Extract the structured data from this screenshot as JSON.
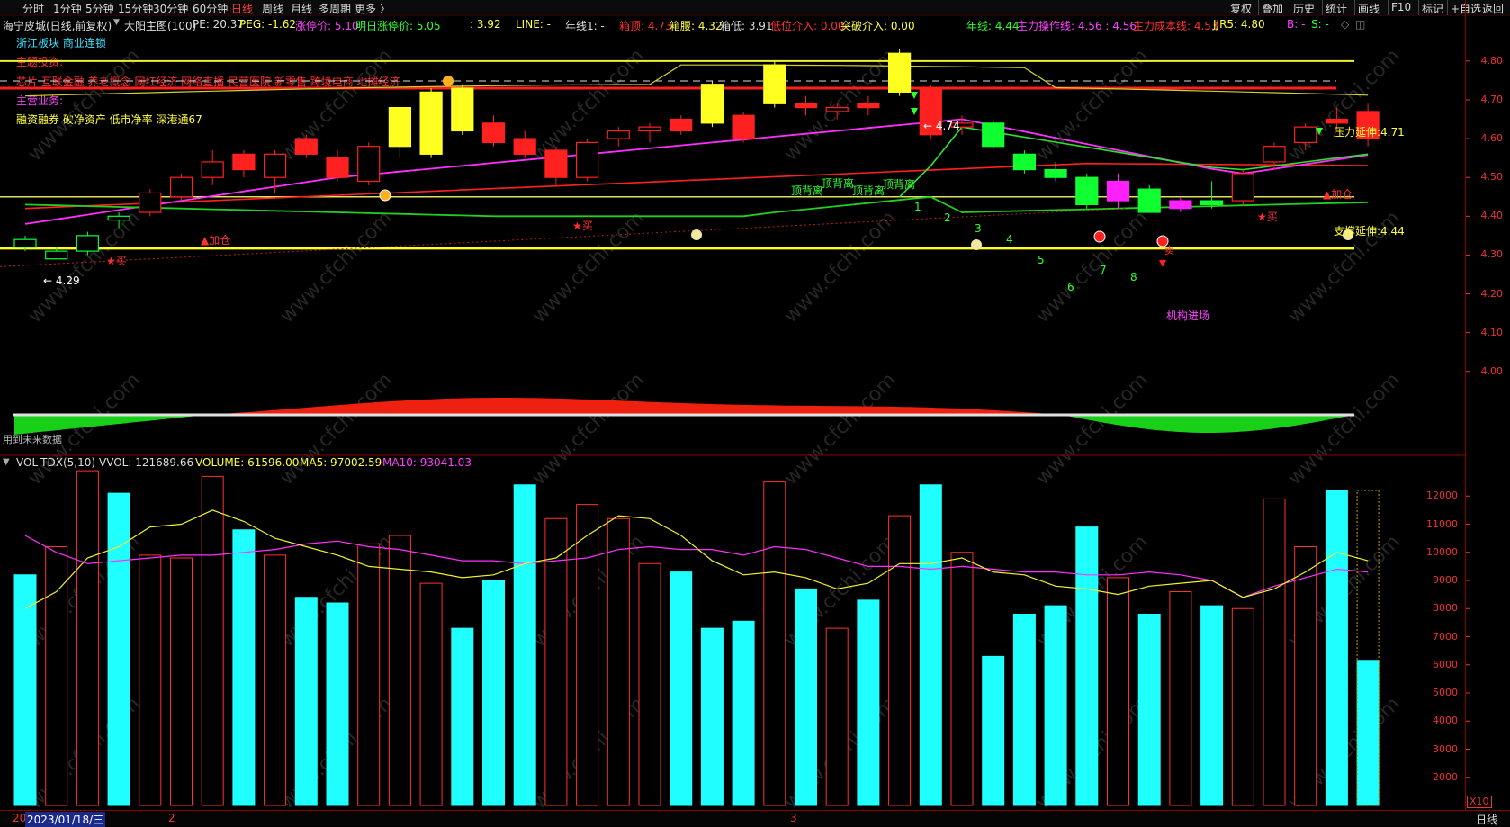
{
  "toolbar": {
    "period_tabs": [
      "分时",
      "1分钟",
      "5分钟",
      "15分钟",
      "30分钟",
      "60分钟",
      "日线",
      "周线",
      "月线",
      "多周期",
      "更多 〉"
    ],
    "selected_period": "日线",
    "right_buttons": [
      "复权",
      "叠加",
      "历史",
      "统计",
      "画线",
      "F10",
      "标记",
      "+自选",
      "返回"
    ]
  },
  "info_line": {
    "stock": "海宁皮城(日线,前复权)",
    "indicator": "大阳主图(100)",
    "pe": "PE: 20.37",
    "peg": "PEG: -1.62",
    "limit_up": "涨停价: 5.10",
    "next_limit_up": "明日涨停价: 5.05",
    "val1": ": 3.92",
    "line": "LINE: -",
    "year_line1": "年线1: -",
    "box_top": "箱顶: 4.73",
    "box_mid": "箱腰: 4.32",
    "box_low": "箱低: 3.91",
    "low_entry": "低位介入: 0.00",
    "break_entry": "突破介入: 0.00",
    "year_line": "年线: 4.44",
    "main_op": "主力操作线: 4.56 : 4.56",
    "main_cost": "主力成本线: 4.53",
    "jjr5": "JJR5: 4.80",
    "b": "B: -",
    "s": "S: -"
  },
  "overlay": {
    "sector": "浙江板块  商业连锁",
    "theme_label": "主题投资:",
    "themes": "芯片  互联金融  养老概念  网红经济  网络直播  民营医院  新零售  跨境电商  地摊经济",
    "business_label": "主营业务:",
    "business": "融资融券  破净资产  低市净率  深港通67",
    "watermark": "www.cfchi.com"
  },
  "annotations": {
    "buy": "★买",
    "add_pos": "▲加仓",
    "top_divergence": "顶背离",
    "pressure": "压力延伸:4.71",
    "support": "支撑延伸:4.44",
    "institution": "机构进场",
    "low_price": "← 4.29",
    "high_price": "← 4.74",
    "counts": [
      "1",
      "2",
      "3",
      "4",
      "5",
      "6",
      "7",
      "8"
    ],
    "sell": "卖"
  },
  "price_axis": [
    "4.80",
    "4.70",
    "4.60",
    "4.50",
    "4.40",
    "4.30",
    "4.20",
    "4.10",
    "4.00"
  ],
  "volume_info": {
    "name": "VOL-TDX(5,10)",
    "vvol": "VVOL: 121689.66",
    "volume": "VOLUME: 61596.00",
    "ma5": "MA5: 97002.59",
    "ma10": "MA10: 93041.03"
  },
  "volume_axis": [
    "12000",
    "11000",
    "10000",
    "9000",
    "8000",
    "7000",
    "6000",
    "5000",
    "4000",
    "3000",
    "2000"
  ],
  "volume_unit": "X10",
  "date_bar": {
    "date": "2023/01/18/三",
    "m1": "20",
    "m2": "2",
    "m3": "3",
    "period": "日线"
  },
  "footer_note": "用到未来数据",
  "colors": {
    "up": "#ff2020",
    "down": "#00ff40",
    "yellow": "#ffff20",
    "magenta": "#ff20ff",
    "cyan": "#20ffff"
  },
  "chart_data": {
    "type": "candlestick",
    "candles": [
      {
        "o": 4.34,
        "c": 4.32,
        "h": 4.35,
        "l": 4.31,
        "t": "down"
      },
      {
        "o": 4.31,
        "c": 4.29,
        "h": 4.32,
        "l": 4.29,
        "t": "down"
      },
      {
        "o": 4.35,
        "c": 4.31,
        "h": 4.36,
        "l": 4.3,
        "t": "down"
      },
      {
        "o": 4.39,
        "c": 4.4,
        "h": 4.41,
        "l": 4.37,
        "t": "down"
      },
      {
        "o": 4.41,
        "c": 4.46,
        "h": 4.47,
        "l": 4.4,
        "t": "uph"
      },
      {
        "o": 4.45,
        "c": 4.5,
        "h": 4.51,
        "l": 4.44,
        "t": "uph"
      },
      {
        "o": 4.5,
        "c": 4.54,
        "h": 4.57,
        "l": 4.48,
        "t": "uph"
      },
      {
        "o": 4.56,
        "c": 4.52,
        "h": 4.57,
        "l": 4.5,
        "t": "dn"
      },
      {
        "o": 4.5,
        "c": 4.56,
        "h": 4.57,
        "l": 4.46,
        "t": "uph"
      },
      {
        "o": 4.6,
        "c": 4.56,
        "h": 4.61,
        "l": 4.55,
        "t": "dn"
      },
      {
        "o": 4.55,
        "c": 4.5,
        "h": 4.57,
        "l": 4.49,
        "t": "dn"
      },
      {
        "o": 4.49,
        "c": 4.58,
        "h": 4.59,
        "l": 4.48,
        "t": "uph"
      },
      {
        "o": 4.58,
        "c": 4.68,
        "h": 4.68,
        "l": 4.55,
        "t": "yl"
      },
      {
        "o": 4.56,
        "c": 4.72,
        "h": 4.73,
        "l": 4.55,
        "t": "yl"
      },
      {
        "o": 4.62,
        "c": 4.73,
        "h": 4.74,
        "l": 4.61,
        "t": "yl"
      },
      {
        "o": 4.64,
        "c": 4.59,
        "h": 4.66,
        "l": 4.58,
        "t": "dn"
      },
      {
        "o": 4.6,
        "c": 4.56,
        "h": 4.62,
        "l": 4.55,
        "t": "dn"
      },
      {
        "o": 4.57,
        "c": 4.5,
        "h": 4.58,
        "l": 4.48,
        "t": "dn"
      },
      {
        "o": 4.5,
        "c": 4.59,
        "h": 4.6,
        "l": 4.49,
        "t": "uph"
      },
      {
        "o": 4.6,
        "c": 4.62,
        "h": 4.63,
        "l": 4.58,
        "t": "uph"
      },
      {
        "o": 4.62,
        "c": 4.63,
        "h": 4.64,
        "l": 4.59,
        "t": "uph"
      },
      {
        "o": 4.62,
        "c": 4.65,
        "h": 4.66,
        "l": 4.61,
        "t": "dn"
      },
      {
        "o": 4.64,
        "c": 4.74,
        "h": 4.75,
        "l": 4.63,
        "t": "yl"
      },
      {
        "o": 4.66,
        "c": 4.6,
        "h": 4.67,
        "l": 4.59,
        "t": "dn"
      },
      {
        "o": 4.69,
        "c": 4.79,
        "h": 4.8,
        "l": 4.68,
        "t": "yl"
      },
      {
        "o": 4.69,
        "c": 4.68,
        "h": 4.71,
        "l": 4.66,
        "t": "dn"
      },
      {
        "o": 4.67,
        "c": 4.68,
        "h": 4.69,
        "l": 4.65,
        "t": "uph"
      },
      {
        "o": 4.68,
        "c": 4.69,
        "h": 4.71,
        "l": 4.66,
        "t": "dn"
      },
      {
        "o": 4.72,
        "c": 4.82,
        "h": 4.83,
        "l": 4.71,
        "t": "yl"
      },
      {
        "o": 4.73,
        "c": 4.61,
        "h": 4.74,
        "l": 4.6,
        "t": "dn"
      },
      {
        "o": 4.64,
        "c": 4.63,
        "h": 4.66,
        "l": 4.61,
        "t": "uph"
      },
      {
        "o": 4.64,
        "c": 4.58,
        "h": 4.65,
        "l": 4.57,
        "t": "gr"
      },
      {
        "o": 4.56,
        "c": 4.52,
        "h": 4.57,
        "l": 4.51,
        "t": "gr"
      },
      {
        "o": 4.52,
        "c": 4.5,
        "h": 4.54,
        "l": 4.49,
        "t": "gr"
      },
      {
        "o": 4.5,
        "c": 4.43,
        "h": 4.51,
        "l": 4.42,
        "t": "gr"
      },
      {
        "o": 4.49,
        "c": 4.44,
        "h": 4.51,
        "l": 4.42,
        "t": "mg"
      },
      {
        "o": 4.47,
        "c": 4.41,
        "h": 4.48,
        "l": 4.41,
        "t": "gr"
      },
      {
        "o": 4.44,
        "c": 4.42,
        "h": 4.45,
        "l": 4.41,
        "t": "mg"
      },
      {
        "o": 4.43,
        "c": 4.44,
        "h": 4.49,
        "l": 4.42,
        "t": "gr"
      },
      {
        "o": 4.44,
        "c": 4.51,
        "h": 4.52,
        "l": 4.43,
        "t": "uph"
      },
      {
        "o": 4.54,
        "c": 4.58,
        "h": 4.59,
        "l": 4.52,
        "t": "uph"
      },
      {
        "o": 4.59,
        "c": 4.63,
        "h": 4.64,
        "l": 4.57,
        "t": "uph"
      },
      {
        "o": 4.64,
        "c": 4.65,
        "h": 4.68,
        "l": 4.62,
        "t": "dn"
      },
      {
        "o": 4.67,
        "c": 4.6,
        "h": 4.69,
        "l": 4.58,
        "t": "dn"
      }
    ],
    "volume": [
      9200,
      10200,
      12900,
      12100,
      9900,
      9800,
      12700,
      10800,
      9900,
      8400,
      8200,
      10300,
      10600,
      8900,
      7300,
      9000,
      12400,
      11200,
      11700,
      11200,
      9600,
      9300,
      7300,
      7550,
      12500,
      8700,
      7300,
      8300,
      11300,
      12400,
      10000,
      6300,
      7800,
      8100,
      10900,
      9100,
      7800,
      8600,
      8100,
      8000,
      11900,
      10200,
      12200,
      6160
    ],
    "volume_colors": [
      "c",
      "o",
      "o",
      "c",
      "o",
      "o",
      "o",
      "c",
      "o",
      "c",
      "c",
      "o",
      "o",
      "o",
      "c",
      "c",
      "c",
      "o",
      "o",
      "o",
      "o",
      "c",
      "c",
      "c",
      "o",
      "c",
      "o",
      "c",
      "o",
      "c",
      "o",
      "c",
      "c",
      "c",
      "c",
      "o",
      "c",
      "o",
      "c",
      "o",
      "o",
      "o",
      "c",
      "c"
    ],
    "ma5": [
      8000,
      8600,
      9800,
      10200,
      10900,
      11000,
      11500,
      11100,
      10500,
      10200,
      9900,
      9500,
      9400,
      9300,
      9100,
      9200,
      9600,
      9800,
      10600,
      11300,
      11200,
      10600,
      9700,
      9200,
      9300,
      9100,
      8700,
      8900,
      9600,
      9600,
      9800,
      9300,
      9200,
      8800,
      8700,
      8500,
      8800,
      8900,
      9000,
      8400,
      8700,
      9300,
      10000,
      9700
    ],
    "ma10": [
      10600,
      10000,
      9600,
      9700,
      9800,
      9900,
      9900,
      10000,
      10100,
      10300,
      10400,
      10200,
      10100,
      9900,
      9700,
      9700,
      9600,
      9700,
      9800,
      10100,
      10200,
      10100,
      10100,
      9900,
      10200,
      10100,
      9800,
      9500,
      9500,
      9400,
      9500,
      9400,
      9300,
      9300,
      9200,
      9200,
      9300,
      9200,
      9000,
      8400,
      8800,
      9100,
      9400,
      9300
    ],
    "price_ylim": [
      3.96,
      4.86
    ],
    "volume_ylim": [
      1000,
      13000
    ]
  }
}
